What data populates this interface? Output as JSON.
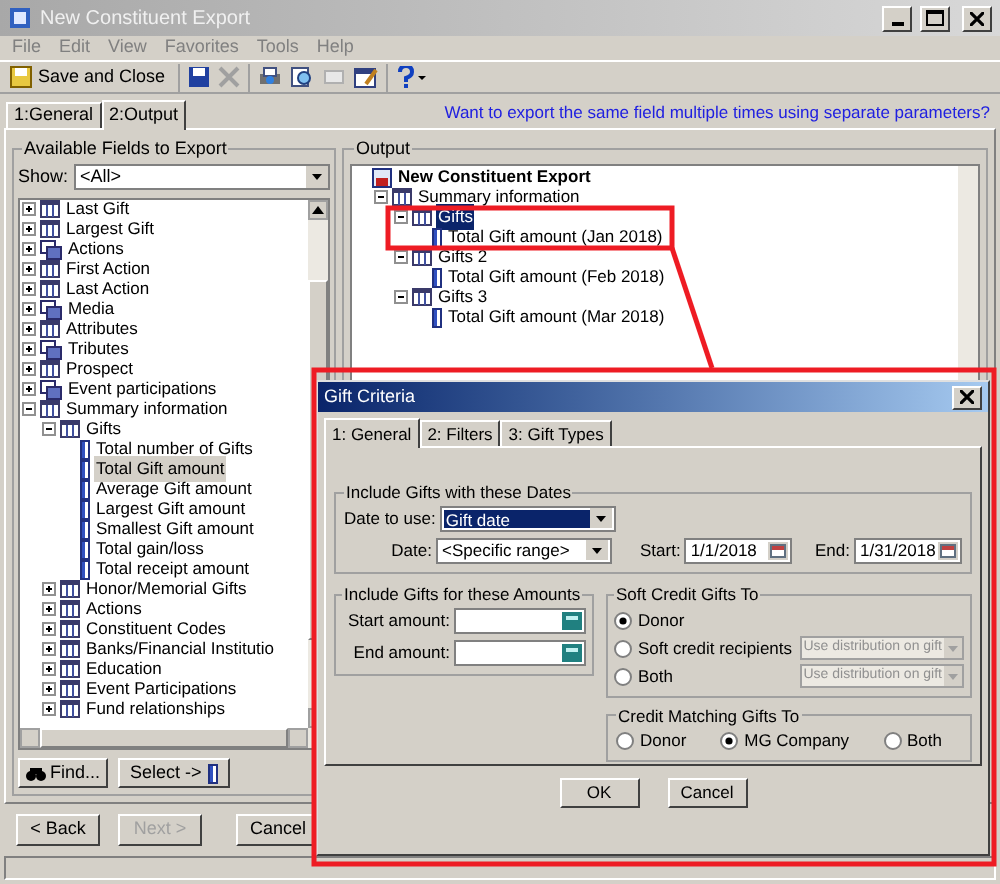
{
  "window": {
    "title": "New Constituent Export",
    "menu": [
      "File",
      "Edit",
      "View",
      "Favorites",
      "Tools",
      "Help"
    ],
    "save_button": "Save and Close"
  },
  "tabs": [
    {
      "label": "1:General",
      "selected": false
    },
    {
      "label": "2:Output",
      "selected": true
    }
  ],
  "help_link": "Want to export the same field multiple times using separate parameters?",
  "available_fields": {
    "title": "Available Fields to Export",
    "show_label": "Show:",
    "show_value": "<All>",
    "tree": [
      {
        "label": "Last Gift",
        "kind": "table",
        "expanded": false,
        "selected": false
      },
      {
        "label": "Largest Gift",
        "kind": "table",
        "expanded": false,
        "selected": false
      },
      {
        "label": "Actions",
        "kind": "multi",
        "expanded": false,
        "selected": false
      },
      {
        "label": "First Action",
        "kind": "table",
        "expanded": false,
        "selected": false
      },
      {
        "label": "Last Action",
        "kind": "table",
        "expanded": false,
        "selected": false
      },
      {
        "label": "Media",
        "kind": "multi",
        "expanded": false,
        "selected": false
      },
      {
        "label": "Attributes",
        "kind": "table",
        "expanded": false,
        "selected": false
      },
      {
        "label": "Tributes",
        "kind": "multi",
        "expanded": false,
        "selected": false
      },
      {
        "label": "Prospect",
        "kind": "table",
        "expanded": false,
        "selected": false
      },
      {
        "label": "Event participations",
        "kind": "multi",
        "expanded": false,
        "selected": false
      },
      {
        "label": "Summary information",
        "kind": "table",
        "expanded": true,
        "selected": false,
        "children": [
          {
            "label": "Gifts",
            "kind": "table",
            "expanded": true,
            "selected": false,
            "children": [
              {
                "label": "Total number of Gifts",
                "kind": "field",
                "selected": false
              },
              {
                "label": "Total Gift amount",
                "kind": "field",
                "selected": true
              },
              {
                "label": "Average Gift amount",
                "kind": "field",
                "selected": false
              },
              {
                "label": "Largest Gift amount",
                "kind": "field",
                "selected": false
              },
              {
                "label": "Smallest Gift amount",
                "kind": "field",
                "selected": false
              },
              {
                "label": "Total gain/loss",
                "kind": "field",
                "selected": false
              },
              {
                "label": "Total receipt amount",
                "kind": "field",
                "selected": false
              }
            ]
          },
          {
            "label": "Honor/Memorial Gifts",
            "kind": "table",
            "expanded": false,
            "selected": false
          },
          {
            "label": "Actions",
            "kind": "table",
            "expanded": false,
            "selected": false
          },
          {
            "label": "Constituent Codes",
            "kind": "table",
            "expanded": false,
            "selected": false
          },
          {
            "label": "Banks/Financial Institutio",
            "kind": "table",
            "expanded": false,
            "selected": false
          },
          {
            "label": "Education",
            "kind": "table",
            "expanded": false,
            "selected": false
          },
          {
            "label": "Event Participations",
            "kind": "table",
            "expanded": false,
            "selected": false
          },
          {
            "label": "Fund relationships",
            "kind": "table",
            "expanded": false,
            "selected": false
          }
        ]
      }
    ],
    "find_button": "Find...",
    "select_button": "Select ->"
  },
  "output": {
    "title": "Output",
    "tree": [
      {
        "label": "New Constituent Export",
        "kind": "root",
        "selected": false,
        "children": [
          {
            "label": "Summary information",
            "kind": "table",
            "expanded": true,
            "selected": false,
            "children": [
              {
                "label": "Gifts",
                "kind": "table",
                "expanded": true,
                "selected": true,
                "children": [
                  {
                    "label": "Total Gift amount (Jan 2018)",
                    "kind": "field",
                    "selected": false
                  }
                ]
              },
              {
                "label": "Gifts 2",
                "kind": "table",
                "expanded": true,
                "selected": false,
                "children": [
                  {
                    "label": "Total Gift amount (Feb 2018)",
                    "kind": "field",
                    "selected": false
                  }
                ]
              },
              {
                "label": "Gifts 3",
                "kind": "table",
                "expanded": true,
                "selected": false,
                "children": [
                  {
                    "label": "Total Gift amount (Mar 2018)",
                    "kind": "field",
                    "selected": false
                  }
                ]
              }
            ]
          }
        ]
      }
    ]
  },
  "nav_buttons": [
    {
      "label": "< Back",
      "disabled": false
    },
    {
      "label": "Next >",
      "disabled": true
    },
    {
      "label": "Cancel",
      "disabled": false
    }
  ],
  "dialog": {
    "title": "Gift Criteria",
    "tabs": [
      {
        "label": "1: General",
        "selected": true
      },
      {
        "label": "2: Filters",
        "selected": false
      },
      {
        "label": "3: Gift Types",
        "selected": false
      }
    ],
    "dates": {
      "title": "Include Gifts with these Dates",
      "date_to_use_label": "Date to use:",
      "date_to_use": "Gift date",
      "date_label": "Date:",
      "date": "<Specific range>",
      "start_label": "Start:",
      "start": "1/1/2018",
      "end_label": "End:",
      "end": "1/31/2018"
    },
    "amounts": {
      "title": "Include Gifts for these Amounts",
      "fields": [
        {
          "label": "Start amount:"
        },
        {
          "label": "End amount:"
        }
      ]
    },
    "soft_credit": {
      "title": "Soft Credit Gifts To",
      "options": [
        {
          "label": "Donor",
          "selected": true
        },
        {
          "label": "Soft credit recipients",
          "selected": false,
          "dropdown": "Use distribution on gift"
        },
        {
          "label": "Both",
          "selected": false,
          "dropdown": "Use distribution on gift"
        }
      ]
    },
    "matching": {
      "title": "Credit Matching Gifts To",
      "options": [
        {
          "label": "Donor",
          "selected": false
        },
        {
          "label": "MG Company",
          "selected": true
        },
        {
          "label": "Both",
          "selected": false
        }
      ]
    },
    "buttons": [
      "OK",
      "Cancel"
    ]
  }
}
